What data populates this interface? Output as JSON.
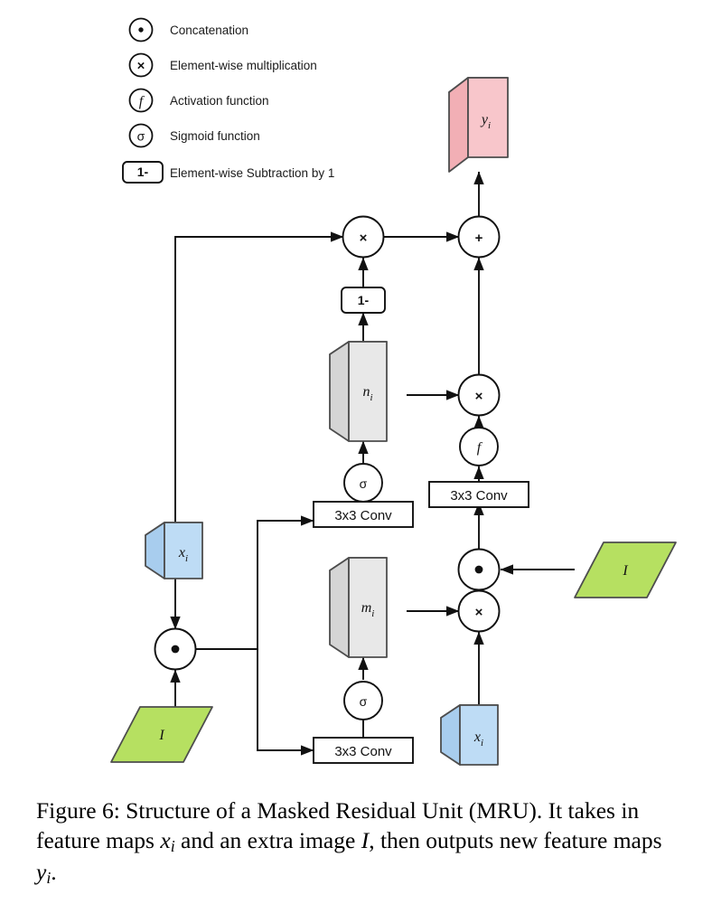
{
  "figure": {
    "caption_prefix": "Figure 6:",
    "caption_line1": "Structure of a Masked Residual Unit (MRU). It",
    "caption_line2_a": "takes in feature maps",
    "caption_line2_b": "and an extra image",
    "caption_line2_c": ", then outputs",
    "caption_line3_a": "new feature maps",
    "caption_line3_b": "."
  },
  "legend": {
    "items": [
      {
        "symbol": "•",
        "icon": "concatenation-icon",
        "label": "Concatenation"
      },
      {
        "symbol": "×",
        "icon": "multiplication-icon",
        "label": "Element-wise multiplication"
      },
      {
        "symbol": "f",
        "icon": "activation-function-icon",
        "label": "Activation function"
      },
      {
        "symbol": "σ",
        "icon": "sigmoid-function-icon",
        "label": "Sigmoid function"
      },
      {
        "symbol": "1-",
        "icon": "subtraction-box-icon",
        "label": "Element-wise Subtraction by 1"
      }
    ]
  },
  "diagram": {
    "tensors": {
      "output_y": "y",
      "output_y_sub": "i",
      "gate_n": "n",
      "gate_n_sub": "i",
      "mask_m": "m",
      "mask_m_sub": "i",
      "input_x_left": "x",
      "input_x_left_sub": "i",
      "input_x_right": "x",
      "input_x_right_sub": "i",
      "image_left": "I",
      "image_right": "I"
    },
    "operators": {
      "mul_top": "×",
      "add_top": "+",
      "mul_right": "×",
      "mul_bottom": "×",
      "concat_left": "•",
      "concat_right": "•",
      "sigmoid_upper": "σ",
      "sigmoid_lower": "σ",
      "activation": "f",
      "subtract_one": "1-"
    },
    "conv_blocks": [
      {
        "id": "conv-n",
        "label": "3x3 Conv"
      },
      {
        "id": "conv-m",
        "label": "3x3 Conv"
      },
      {
        "id": "conv-residual",
        "label": "3x3 Conv"
      }
    ],
    "colors": {
      "output_pink": "#F8C6CB",
      "output_pink_side": "#F2AFB5",
      "input_blue": "#BEDCF5",
      "input_blue_side": "#A8CDEE",
      "gate_gray": "#E8E8E8",
      "gate_gray_side": "#D5D5D5",
      "image_green": "#B6E061",
      "stroke_dark": "#4d4d4d",
      "line_black": "#111111"
    }
  }
}
